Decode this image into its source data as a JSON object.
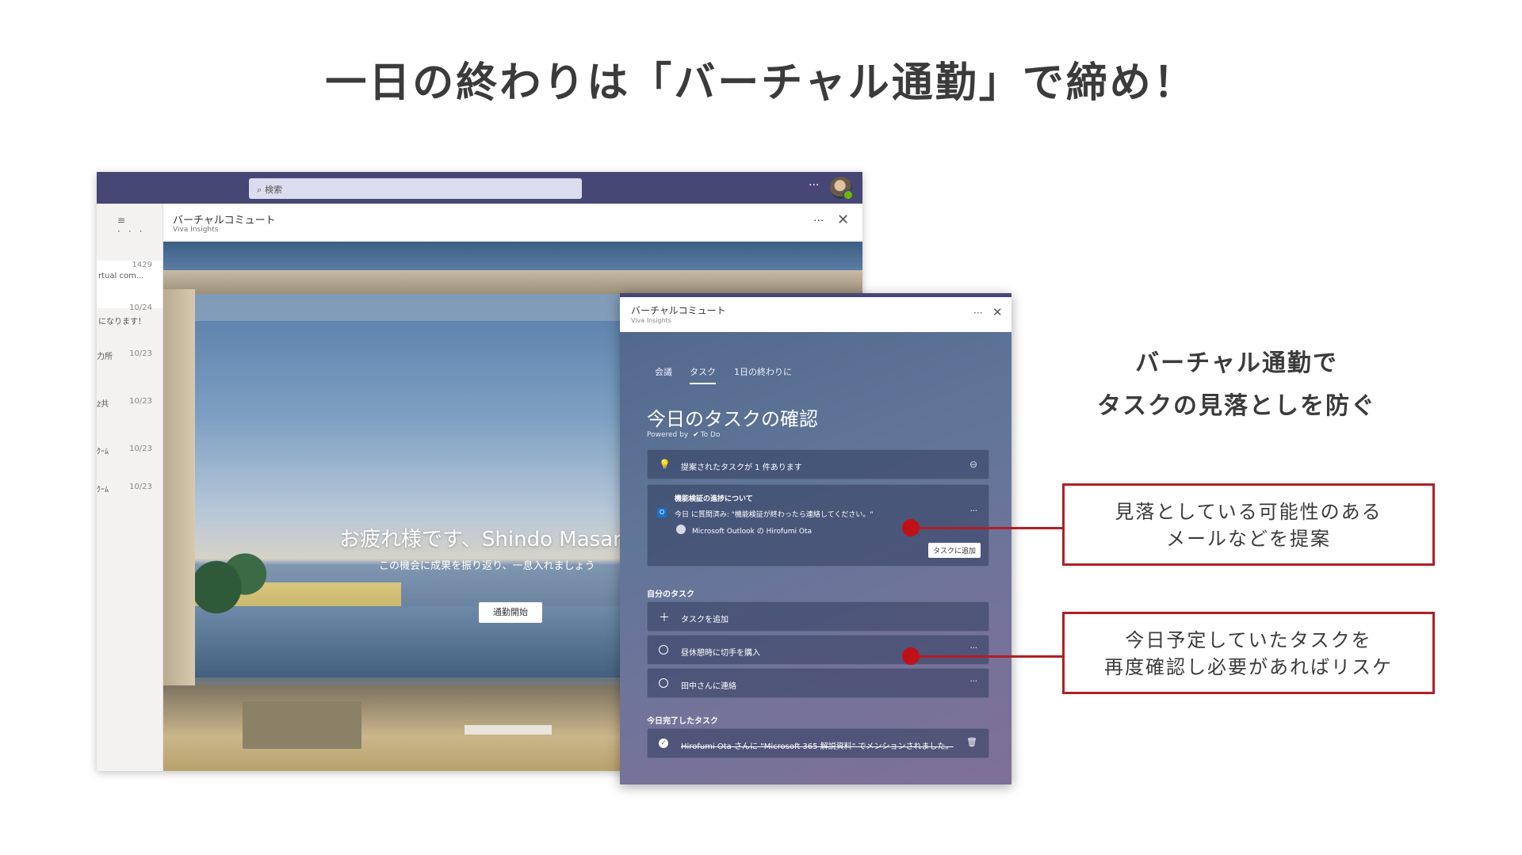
{
  "slide": {
    "title": "一日の終わりは「バーチャル通勤」で締め！",
    "side_text_line1": "バーチャル通勤で",
    "side_text_line2": "タスクの見落としを防ぐ",
    "callout1_line1": "見落としている可能性のある",
    "callout1_line2": "メールなどを提案",
    "callout2_line1": "今日予定していたタスクを",
    "callout2_line2": "再度確認し必要があればリスケ",
    "accent_color": "#b01f24"
  },
  "teams": {
    "search_placeholder": "検索",
    "more": "···",
    "list_tools": "≡ ···",
    "list": [
      {
        "date": "1429",
        "text": "rtual com..."
      },
      {
        "date": "10/24",
        "text": "になります！"
      },
      {
        "date": "10/23",
        "text": "力所"
      },
      {
        "date": "10/23",
        "text": "ż共"
      },
      {
        "date": "10/23",
        "text": "ｸｰﾑ"
      },
      {
        "date": "10/23",
        "text": "ｸｰﾑ"
      }
    ],
    "app_title": "バーチャルコミュート",
    "app_sub": "Viva Insights",
    "greeting": "お疲れ様です、Shindo Masaru",
    "message": "この機会に成果を振り返り、一息入れましょう",
    "start_button": "通勤開始",
    "close": "✕"
  },
  "viva": {
    "title": "バーチャルコミュート",
    "sub": "Viva Insights",
    "more": "···",
    "close": "✕",
    "tabs": [
      "会議",
      "タスク",
      "1日の終わりに"
    ],
    "heading": "今日のタスクの確認",
    "powered_by": "Powered by",
    "powered_app": "To Do",
    "suggest_text": "提案されたタスクが 1 件あります",
    "mail_subject": "機能検証の進捗について",
    "mail_preview": "今日 に質問済み: \"機能検証が終わったら連絡してください。\"",
    "mail_source": "Microsoft Outlook の Hirofumi Ota",
    "add_task_button": "タスクに追加",
    "my_tasks_label": "自分のタスク",
    "add_task": "タスクを追加",
    "task1": "昼休憩時に切手を購入",
    "task2": "田中さんに連絡",
    "done_label": "今日完了したタスク",
    "done_task": "Hirofumi Ota さんに \"Microsoft 365 解説資料\" でメンションされました。"
  }
}
